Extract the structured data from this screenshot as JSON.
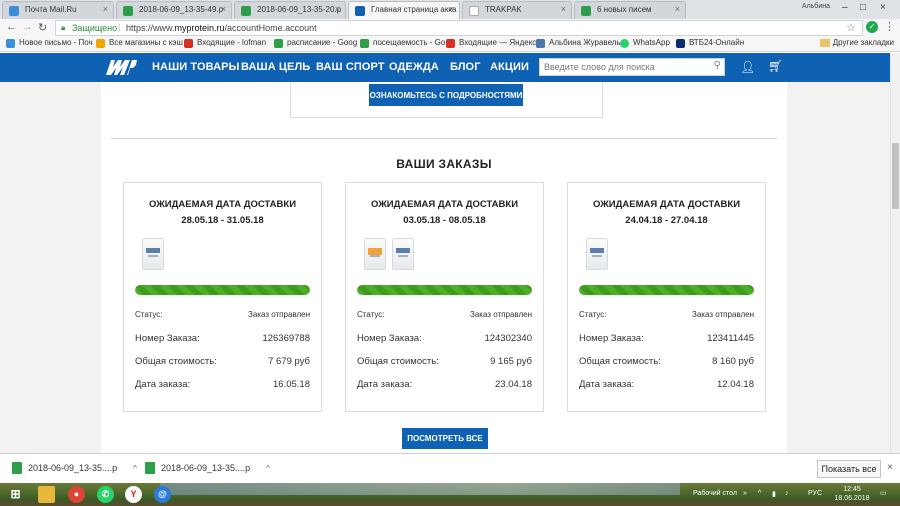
{
  "browser": {
    "tabs": [
      {
        "title": "Почта Mail.Ru",
        "favicon_color": "#3a8fd6"
      },
      {
        "title": "2018-06-09_13-35-49.p",
        "favicon_color": "#2e9e4a"
      },
      {
        "title": "2018-06-09_13-35-20.p",
        "favicon_color": "#2e9e4a"
      },
      {
        "title": "Главная страница акка",
        "favicon_color": "#0e61b3"
      },
      {
        "title": "TRAKPAK",
        "favicon_color": "#cccccc"
      },
      {
        "title": "6 новых писем",
        "favicon_color": "#2e9e4a"
      }
    ],
    "user_label": "Альбина",
    "secure_label": "Защищено",
    "url_prefix": "https://www.",
    "url_domain": "myprotein.ru",
    "url_path": "/accountHome.account",
    "bookmarks": [
      {
        "label": "Новое письмо - Поч",
        "color": "#3a8fd6"
      },
      {
        "label": "Все магазины с кэш",
        "color": "#f1a500"
      },
      {
        "label": "Входящие - lofman",
        "color": "#d93025"
      },
      {
        "label": "расписание - Goog",
        "color": "#2e9e4a"
      },
      {
        "label": "посещаемость - Go",
        "color": "#2e9e4a"
      },
      {
        "label": "Входящие — Яндекс",
        "color": "#d93025"
      },
      {
        "label": "Альбина Журавель",
        "color": "#4a76a8"
      },
      {
        "label": "WhatsApp",
        "color": "#25d366"
      },
      {
        "label": "ВТБ24-Онлайн",
        "color": "#0a2973"
      }
    ],
    "other_bookmarks": "Другие закладки"
  },
  "site": {
    "nav": [
      "НАШИ ТОВАРЫ",
      "ВАША ЦЕЛЬ",
      "ВАШ СПОРТ",
      "ОДЕЖДА",
      "БЛОГ",
      "АКЦИИ"
    ],
    "search_placeholder": "Введите слово для поиска",
    "promo_button": "ОЗНАКОМЬТЕСЬ С ПОДРОБНОСТЯМИ",
    "orders_title": "ВАШИ ЗАКАЗЫ",
    "view_all_button": "ПОСМОТРЕТЬ ВСЕ",
    "labels": {
      "status": "Статус:",
      "order_number": "Номер Заказа:",
      "total": "Общая стоимость:",
      "order_date": "Дата заказа:"
    },
    "orders": [
      {
        "title": "ОЖИДАЕМАЯ ДАТА ДОСТАВКИ 28.05.18 - 31.05.18",
        "items": 1,
        "progress": 100,
        "status": "Заказ отправлен",
        "number": "126369788",
        "total": "7 679 руб",
        "date": "16.05.18"
      },
      {
        "title": "ОЖИДАЕМАЯ ДАТА ДОСТАВКИ 03.05.18 - 08.05.18",
        "items": 2,
        "progress": 100,
        "status": "Заказ отправлен",
        "number": "124302340",
        "total": "9 165 руб",
        "date": "23.04.18"
      },
      {
        "title": "ОЖИДАЕМАЯ ДАТА ДОСТАВКИ 24.04.18 - 27.04.18",
        "items": 1,
        "progress": 100,
        "status": "Заказ отправлен",
        "number": "123411445",
        "total": "8 160 руб",
        "date": "12.04.18"
      }
    ]
  },
  "downloads": {
    "files": [
      "2018-06-09_13-35....p",
      "2018-06-09_13-35....p"
    ],
    "show_all": "Показать все"
  },
  "taskbar": {
    "desktop_label": "Рабочий стол",
    "lang": "РУС",
    "time": "12:45",
    "date": "18.06.2018"
  },
  "colors": {
    "brand_blue": "#0e61b3",
    "progress_green": "#4caf26"
  }
}
